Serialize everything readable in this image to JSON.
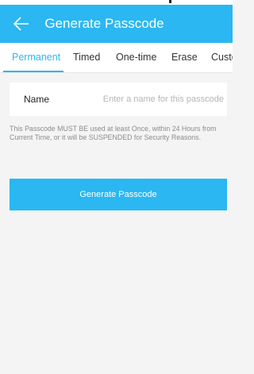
{
  "header": {
    "title": "Generate Passcode",
    "back_icon": "back-arrow-icon"
  },
  "tabs": [
    {
      "label": "Permanent",
      "active": true
    },
    {
      "label": "Timed",
      "active": false
    },
    {
      "label": "One-time",
      "active": false
    },
    {
      "label": "Erase",
      "active": false
    },
    {
      "label": "Custo",
      "active": false
    }
  ],
  "form": {
    "name_label": "Name",
    "name_placeholder": "Enter a name for this passcode",
    "name_value": ""
  },
  "notice": "This Passcode MUST BE used at least Once, within 24 Hours from Current Time, or it will be SUSPENDED for Security Reasons.",
  "action": {
    "generate_label": "Generate Passcode"
  },
  "colors": {
    "accent": "#2ab7f2",
    "background": "#f4f4f4",
    "surface": "#ffffff",
    "muted_text": "#8c8c8c"
  }
}
